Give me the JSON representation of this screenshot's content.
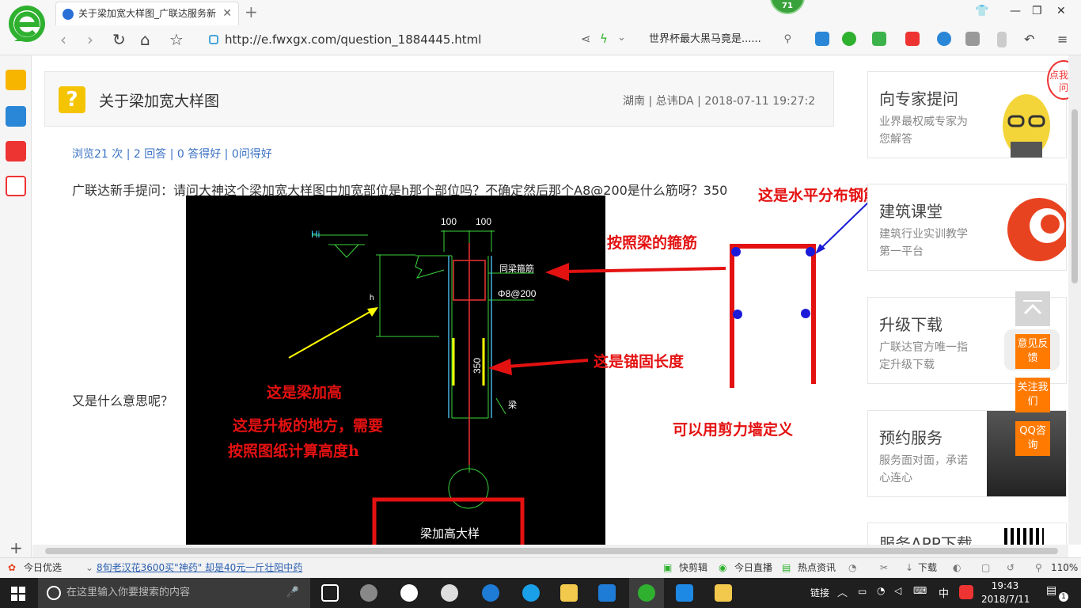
{
  "browser": {
    "tab_title": "关于梁加宽大样图_广联达服务新",
    "badge": "71",
    "url": "http://e.fwxgx.com/question_1884445.html",
    "search_text": "世界杯最大黑马竟是......"
  },
  "question": {
    "title": "关于梁加宽大样图",
    "meta": "湖南 | 总讳DA | 2018-07-11 19:27:2",
    "stats": "浏览21 次 | 2 回答 | 0 答得好 | 0问得好",
    "body_line1": "广联达新手提问：请问大神这个梁加宽大样图中加宽部位是h那个部位吗？不确定然后那个A8@200是什么筋呀？350",
    "body_line2": "又是什么意思呢？"
  },
  "cad": {
    "dim_left": "100",
    "dim_right": "100",
    "level_label": "Hi",
    "h_label": "h",
    "stirrup_label": "同梁箍筋",
    "rebar_label": "Φ8@200",
    "dim_350": "350",
    "beam_label": "梁",
    "caption": "梁加高大样"
  },
  "annotations": {
    "horizontal_rebar": "这是水平分布钢筋",
    "beam_stirrup": "按照梁的箍筋",
    "anchor_length": "这是锚固长度",
    "beam_raise": "这是梁加高",
    "slab_raise_1": "这是升板的地方，需要",
    "slab_raise_2": "按照图纸计算高度h",
    "shear_wall": "可以用剪力墙定义"
  },
  "sidebar_cards": [
    {
      "title": "向专家提问",
      "subtitle": "业界最权威专家为您解答"
    },
    {
      "title": "建筑课堂",
      "subtitle": "建筑行业实训教学第一平台"
    },
    {
      "title": "升级下载",
      "subtitle": "广联达官方唯一指定升级下载"
    },
    {
      "title": "预约服务",
      "subtitle": "服务面对面，承诺心连心"
    },
    {
      "title": "服务APP下载",
      "subtitle": ""
    }
  ],
  "ad_badge": "点我提问",
  "float_buttons": [
    "意见反馈",
    "关注我们",
    "QQ咨询"
  ],
  "status_bar": {
    "today": "今日优选",
    "news": "8旬老汉花3600买\"神药\" 却是40元一斤壮阳中药",
    "kuaijian": "快剪辑",
    "live": "今日直播",
    "hot": "热点资讯",
    "download": "下载",
    "zoom": "110%"
  },
  "taskbar": {
    "search_placeholder": "在这里输入你要搜索的内容",
    "link": "链接",
    "ime": "中",
    "time": "19:43",
    "date": "2018/7/11",
    "notif": "1"
  },
  "colors": {
    "annotation_red": "#e41111",
    "link_blue": "#3a72c4",
    "float_orange": "#ff7a00",
    "brand_green": "#3aa23a"
  }
}
